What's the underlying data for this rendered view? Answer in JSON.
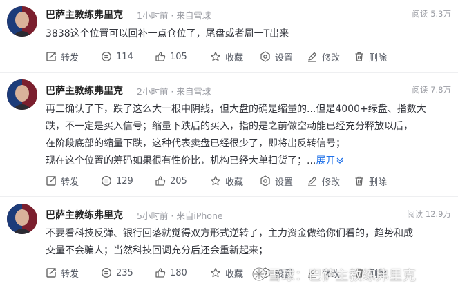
{
  "posts": [
    {
      "author": "巴萨主教练弗里克",
      "time": "1小时前",
      "source": "来自雪球",
      "reads": "阅读 5.3万",
      "lines": [
        "3838这个位置可以回补一点仓位了，尾盘或者周一T出来"
      ],
      "expand": "",
      "actions": {
        "repost": "转发",
        "comments": "114",
        "likes": "105",
        "favorite": "收藏",
        "settings": "设置",
        "edit": "修改",
        "delete": "删除"
      }
    },
    {
      "author": "巴萨主教练弗里克",
      "time": "2小时前",
      "source": "来自雪球",
      "reads": "阅读 7.8万",
      "lines": [
        "再三确认了下，跌了这么大一根中阴线，但大盘的确是缩量的...但是4000+绿盘、指数大",
        "跌，不一定是买入信号；缩量下跌后的买入，指的是之前做空动能已经充分释放以后，",
        "在阶段底部的缩量下跌，这种代表卖盘已经很少了，即将出反转信号；",
        "现在这个位置的筹码如果很有性价比，机构已经大单扫货了；..."
      ],
      "expand": "展开",
      "actions": {
        "repost": "转发",
        "comments": "129",
        "likes": "205",
        "favorite": "收藏",
        "settings": "设置",
        "edit": "修改",
        "delete": "删除"
      }
    },
    {
      "author": "巴萨主教练弗里克",
      "time": "5小时前",
      "source": "来自iPhone",
      "reads": "阅读 12.9万",
      "lines": [
        "不要看科技反弹、银行回落就觉得双方形式逆转了，主力资金做给你们看的，趋势和成",
        "交量不会骗人；当然科技回调充分后还会重新起来；"
      ],
      "expand": "",
      "actions": {
        "repost": "转发",
        "comments": "235",
        "likes": "180",
        "favorite": "收藏",
        "settings": "设置",
        "edit": "修改",
        "delete": "删除"
      }
    }
  ],
  "watermark": "雪球：巴萨主教练弗里克",
  "colors": {
    "link": "#1d6fe8",
    "meta": "#9a9ca3",
    "text": "#33353c"
  }
}
